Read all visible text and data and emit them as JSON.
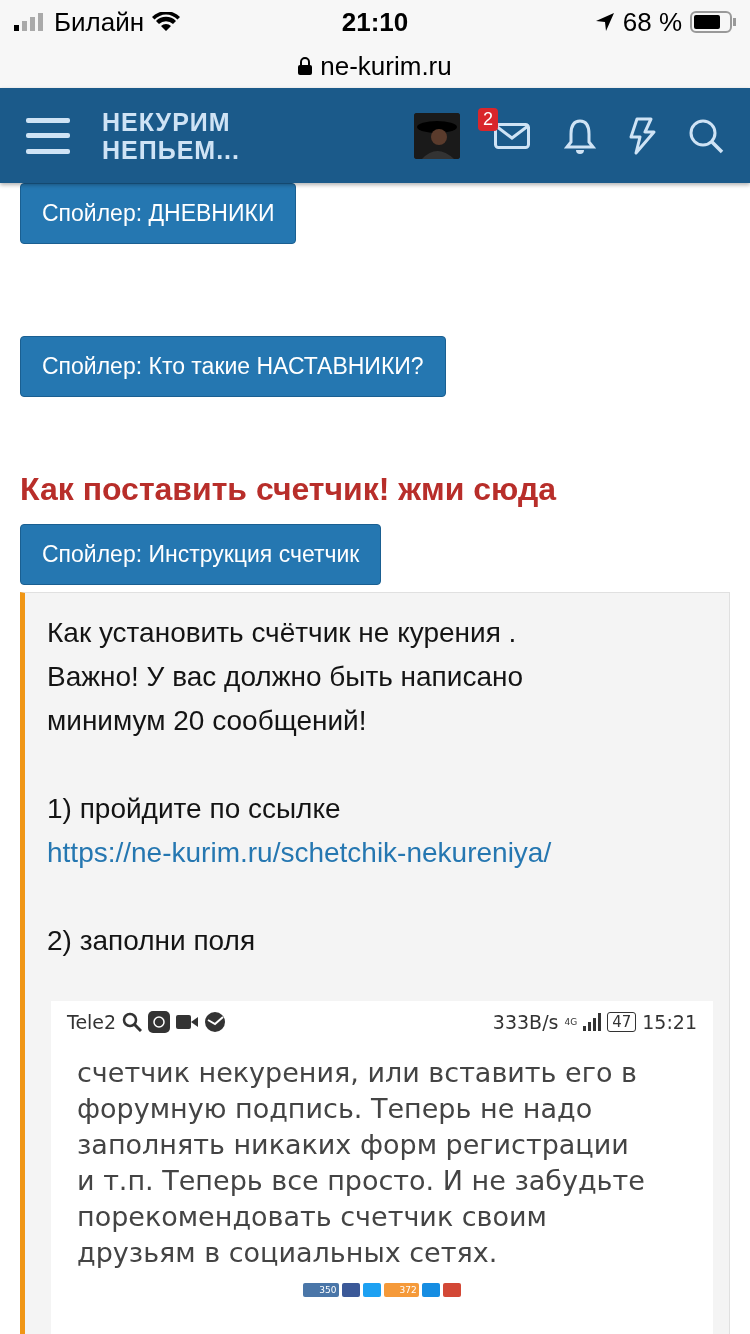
{
  "status_bar": {
    "carrier": "Билайн",
    "time": "21:10",
    "battery": "68 %"
  },
  "address_bar": {
    "url": "ne-kurim.ru"
  },
  "header": {
    "logo_lines": [
      "НЕКУРИМ",
      "НЕПЬЕМ..."
    ],
    "message_badge": "2"
  },
  "content": [
    {
      "kind": "spoiler",
      "label": "Спойлер: ДНЕВНИКИ"
    },
    {
      "kind": "spoiler",
      "label": "Спойлер: Кто такие НАСТАВНИКИ?"
    },
    {
      "kind": "heading",
      "text": "Как поставить счетчик! жми сюда"
    },
    {
      "kind": "spoiler",
      "label": "Спойлер: Инструкция счетчик"
    }
  ],
  "quote": {
    "paragraphs": [
      {
        "lines": [
          "Как установить счётчик не курения .",
          "Важно! У вас должно быть написано",
          "минимум 20 сообщений!"
        ]
      },
      {
        "text": "1) пройдите по ссылке ",
        "link": "https://ne-kurim.ru/schetchik-nekureniya/"
      },
      {
        "text": "2) заполни поля"
      }
    ],
    "screenshot": {
      "status_left": "Tele2",
      "speed": "333B/s",
      "network": "4G",
      "battery": "47",
      "time": "15:21",
      "lines": [
        "счетчик некурения, или вставить его в",
        "форумную подпись. Теперь не надо",
        "заполнять никаких форм регистрации",
        "и т.п. Теперь все просто. И не забудьте",
        "порекомендовать счетчик своим",
        "друзьям в социальных сетях."
      ],
      "share_buttons": [
        {
          "color": "#4a76a8",
          "count": "350"
        },
        {
          "color": "#3b5998"
        },
        {
          "color": "#1da1f2"
        },
        {
          "color": "#f59a3a",
          "count": "372"
        },
        {
          "color": "#168de2"
        },
        {
          "color": "#d34836"
        }
      ]
    }
  }
}
